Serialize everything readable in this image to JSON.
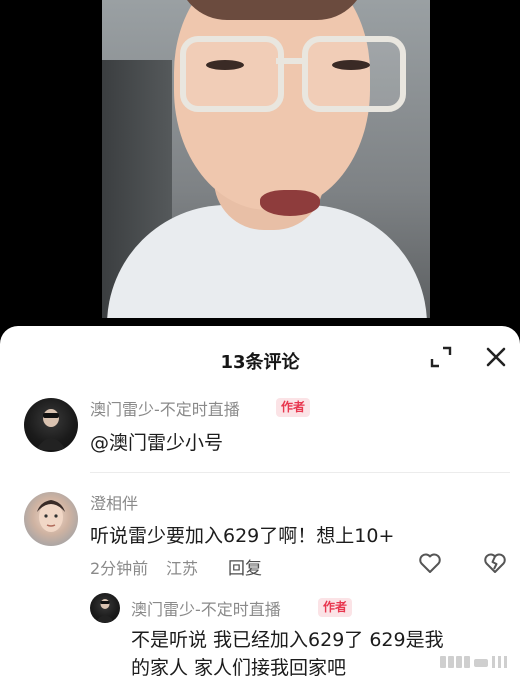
{
  "sheet": {
    "title": "13条评论",
    "expand_icon": "expand-icon",
    "close_icon": "close-icon"
  },
  "comments": [
    {
      "username": "澳门雷少-不定时直播",
      "badge": "作者",
      "content": "@澳门雷少小号"
    },
    {
      "username": "澄相伴",
      "content": "听说雷少要加入629了啊！想上10+",
      "time": "2分钟前",
      "location": "江苏",
      "reply_label": "回复",
      "like_icon": "heart-icon",
      "dislike_icon": "broken-heart-icon",
      "replies": [
        {
          "username": "澳门雷少-不定时直播",
          "badge": "作者",
          "content_line1": "不是听说 我已经加入629了 629是我",
          "content_line2": "的家人 家人们接我回家吧"
        }
      ]
    }
  ],
  "colors": {
    "badge_text": "#e8374f",
    "badge_bg": "#fbe3e6",
    "sheet_bg": "#ffffff"
  }
}
